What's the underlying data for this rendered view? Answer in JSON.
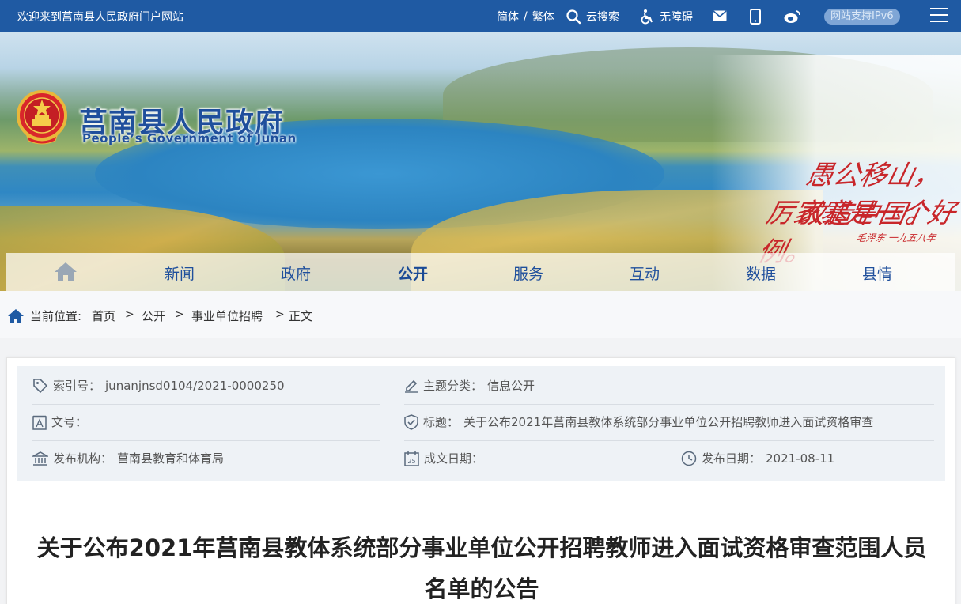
{
  "topbar": {
    "welcome": "欢迎来到莒南县人民政府门户网站",
    "lang_simplified": "简体",
    "lang_sep": "/",
    "lang_traditional": "繁体",
    "search": "云搜索",
    "accessibility": "无障碍",
    "ipv6": "网站支持IPv6"
  },
  "banner": {
    "title": "莒南县人民政府",
    "subtitle": "People’s Government of Junan",
    "calligraphy_line1": "愚公移山，改造中国。",
    "calligraphy_line2": "厉家寨是一个好例。",
    "calligraphy_sign": "毛泽东 一九五八年"
  },
  "nav": {
    "items": [
      "新闻",
      "政府",
      "公开",
      "服务",
      "互动",
      "数据",
      "县情"
    ],
    "active": "公开"
  },
  "breadcrumb": {
    "label": "当前位置:",
    "items": [
      "首页",
      "公开",
      "事业单位招聘",
      "正文"
    ],
    "sep": ">"
  },
  "meta": {
    "index_label": "索引号：",
    "index_value": "junanjnsd0104/2021-0000250",
    "topic_label": "主题分类：",
    "topic_value": "信息公开",
    "docno_label": "文号：",
    "docno_value": "",
    "subject_label": "标题：",
    "subject_value": "关于公布2021年莒南县教体系统部分事业单位公开招聘教师进入面试资格审查",
    "publisher_label": "发布机构：",
    "publisher_value": "莒南县教育和体育局",
    "written_label": "成文日期：",
    "written_value": "",
    "pubdate_label": "发布日期：",
    "pubdate_value": "2021-08-11"
  },
  "article": {
    "title_line1": "关于公布2021年莒南县教体系统部分事业单位公开招聘教师进入面试资格审查范围人员",
    "title_line2": "名单的公告"
  },
  "colors": {
    "topbar": "#1f5aa3",
    "nav_text": "#1f4f9c",
    "meta_bg": "#eef2f6"
  }
}
